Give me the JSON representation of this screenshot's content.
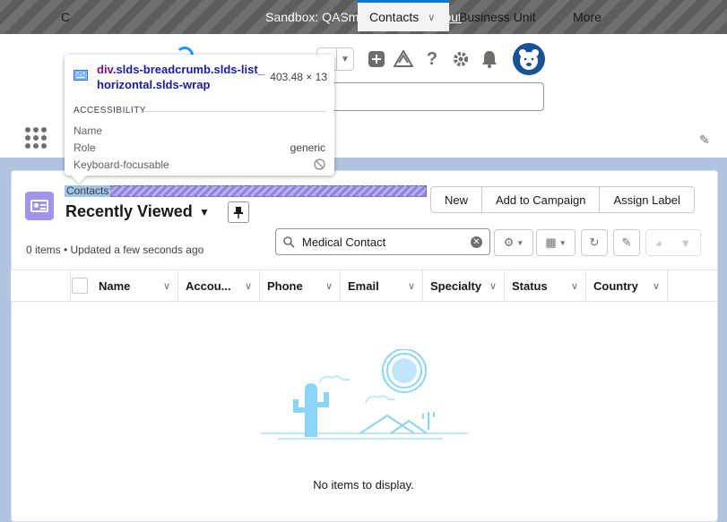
{
  "sandbox": {
    "label": "Sandbox: QASmartCRM |",
    "logout": "Log out"
  },
  "nav": {
    "app_name_partial": "C",
    "items": [
      {
        "label": "Contacts",
        "active": true
      },
      {
        "label": "Business Unit",
        "active": false
      },
      {
        "label": "More",
        "active": false
      }
    ]
  },
  "list": {
    "breadcrumb": "Contacts",
    "title": "Recently Viewed",
    "meta": "0 items • Updated a few seconds ago",
    "buttons": [
      "New",
      "Add to Campaign",
      "Assign Label"
    ],
    "search_value": "Medical Contact",
    "columns": [
      "Name",
      "Accou...",
      "Phone",
      "Email",
      "Specialty",
      "Status",
      "Country"
    ],
    "empty_message": "No items to display."
  },
  "tooltip": {
    "selector_tag": "div",
    "selector_classes": ".slds-breadcrumb.slds-list_horizontal.slds-wrap",
    "size": "403.48 × 13",
    "section": "ACCESSIBILITY",
    "rows": [
      {
        "label": "Name",
        "value": ""
      },
      {
        "label": "Role",
        "value": "generic"
      },
      {
        "label": "Keyboard-focusable",
        "value": ""
      }
    ]
  },
  "colors": {
    "accent": "#0176d3",
    "contact_icon": "#a094ed",
    "tooltip_tag": "#881280",
    "tooltip_class": "#1a1aa6"
  }
}
